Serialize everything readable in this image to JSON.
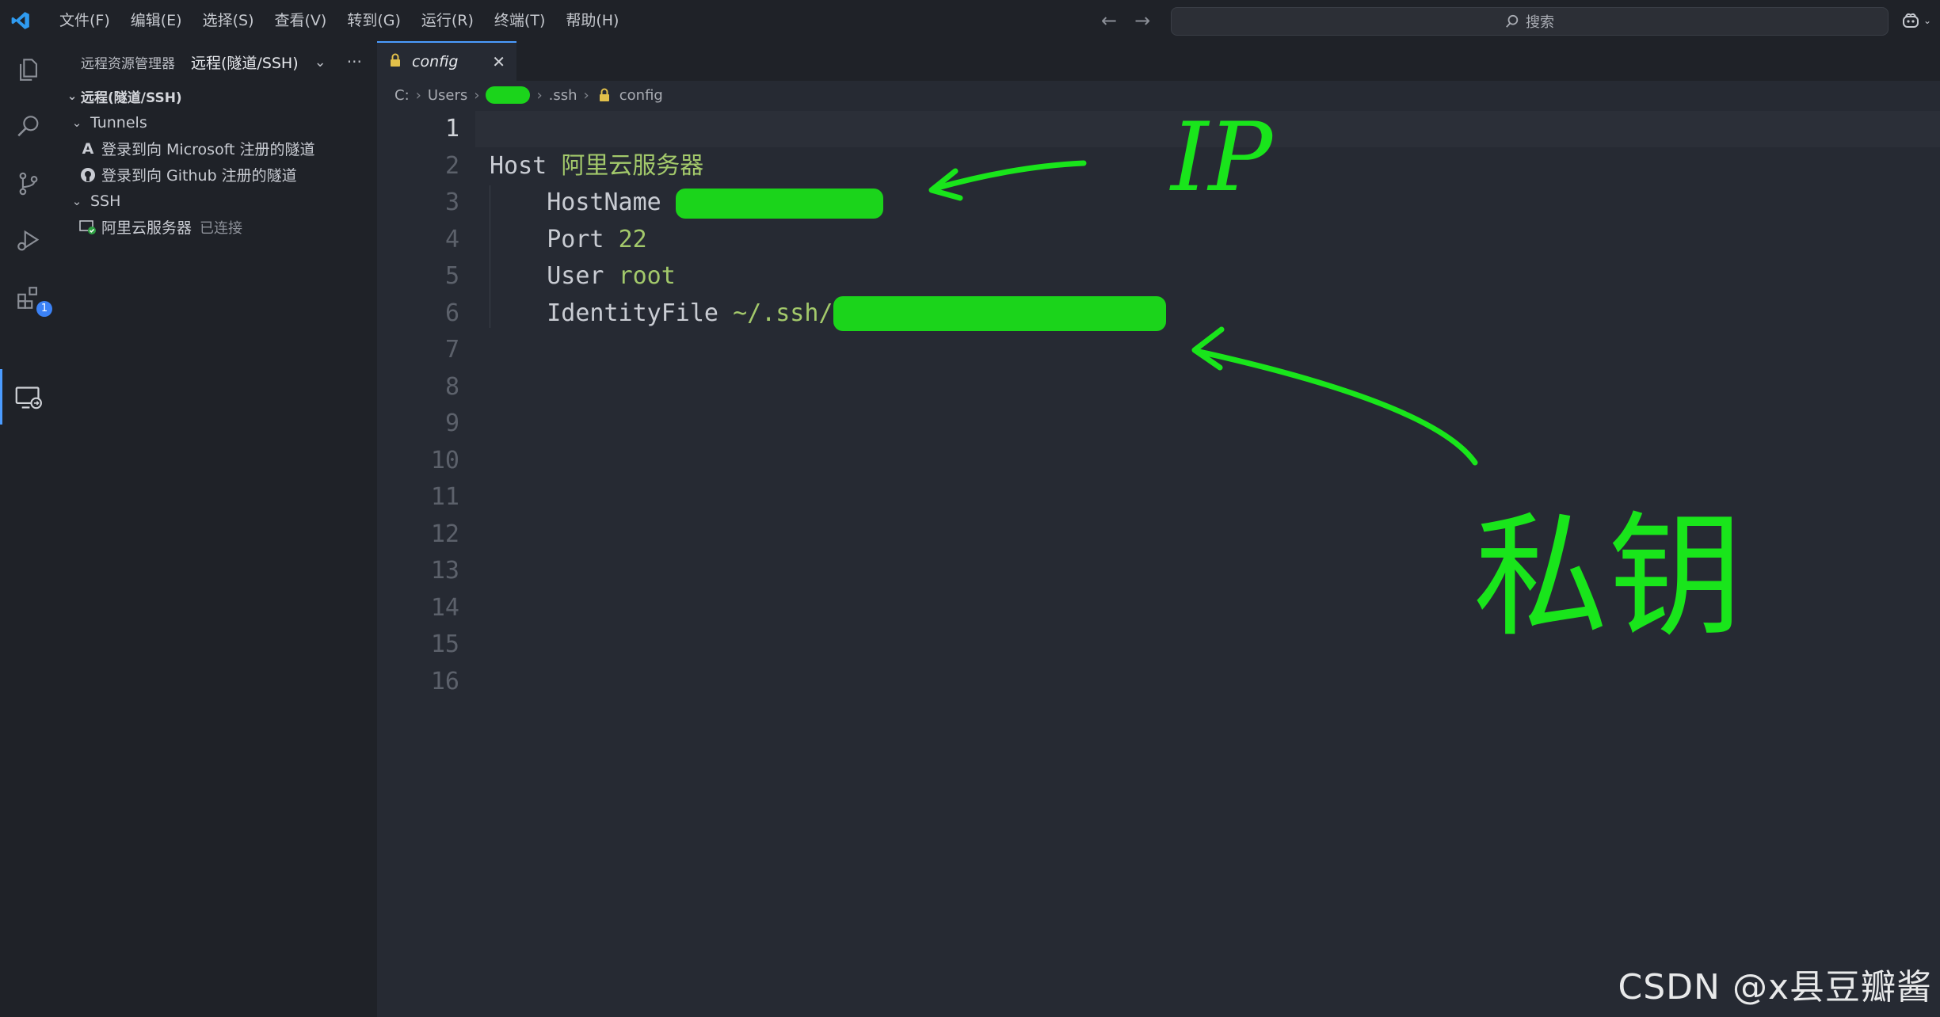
{
  "menu": [
    "文件(F)",
    "编辑(E)",
    "选择(S)",
    "查看(V)",
    "转到(G)",
    "运行(R)",
    "终端(T)",
    "帮助(H)"
  ],
  "search": {
    "label": "搜索"
  },
  "activity": {
    "extensions_badge": "1"
  },
  "sidebar": {
    "view_title": "远程资源管理器",
    "selected_view": "远程(隧道/SSH)",
    "section_title": "远程(隧道/SSH)",
    "tunnels_group": "Tunnels",
    "tunnel_items": [
      "登录到向 Microsoft 注册的隧道",
      "登录到向 Github 注册的隧道"
    ],
    "ssh_group": "SSH",
    "ssh_host": "阿里云服务器",
    "ssh_status": "已连接"
  },
  "editor": {
    "tab_name": "config",
    "breadcrumb": [
      "C:",
      "Users",
      ".ssh",
      "config"
    ],
    "line_numbers": [
      "1",
      "2",
      "3",
      "4",
      "5",
      "6",
      "7",
      "8",
      "9",
      "10",
      "11",
      "12",
      "13",
      "14",
      "15",
      "16"
    ],
    "lines": {
      "host_kw": "Host",
      "host_val": "阿里云服务器",
      "hostname_kw": "HostName",
      "port_kw": "Port",
      "port_val": "22",
      "user_kw": "User",
      "user_val": "root",
      "identity_kw": "IdentityFile",
      "identity_val": "~/.ssh/"
    }
  },
  "annotations": {
    "ip": "IP",
    "private_key": "私钥"
  },
  "watermark": "CSDN @x县豆瓣酱",
  "colors": {
    "accent": "#4b9cff",
    "string": "#a3c96b",
    "annotation": "#19e51b",
    "background": "#262a33"
  }
}
